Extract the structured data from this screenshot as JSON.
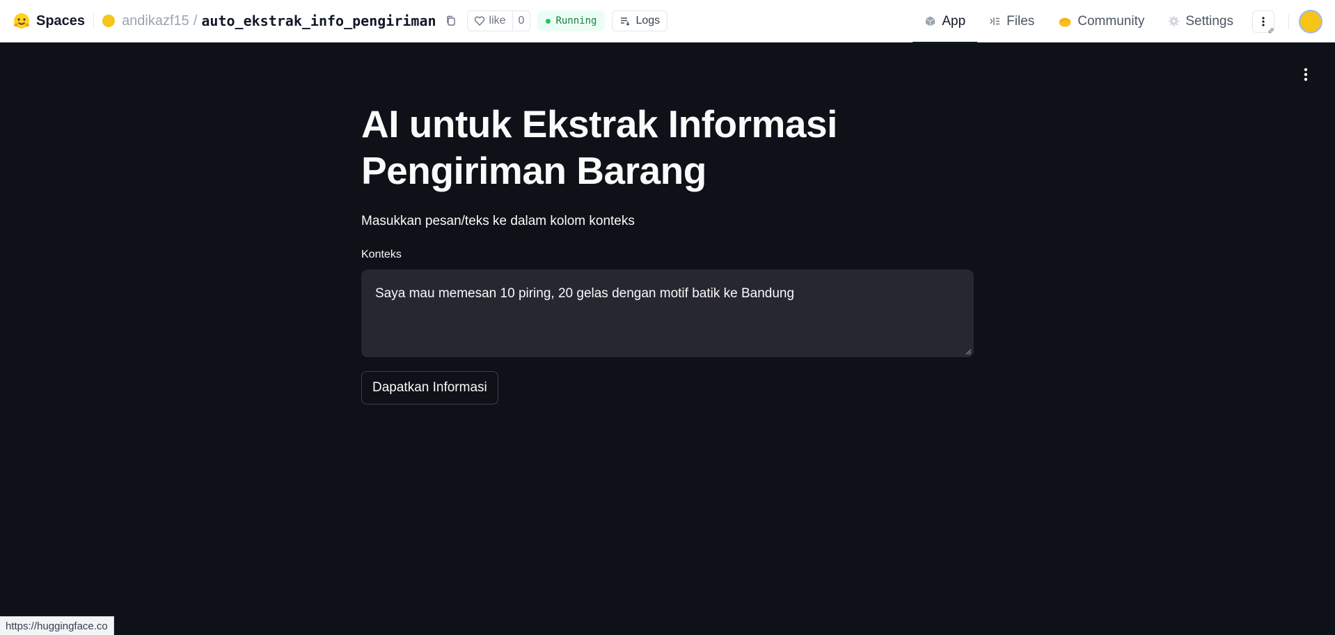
{
  "header": {
    "brand": "Spaces",
    "repo_owner": "andikazf15",
    "repo_separator": "/",
    "repo_name": "auto_ekstrak_info_pengiriman",
    "like_label": "like",
    "like_count": "0",
    "status": "Running",
    "logs_label": "Logs",
    "nav": [
      {
        "label": "App",
        "icon": "cube-icon",
        "active": true
      },
      {
        "label": "Files",
        "icon": "files-icon",
        "active": false
      },
      {
        "label": "Community",
        "icon": "community-icon",
        "active": false
      },
      {
        "label": "Settings",
        "icon": "gear-icon",
        "active": false
      }
    ],
    "colors": {
      "status_green": "#22c55e",
      "avatar": "#f5c518"
    }
  },
  "app": {
    "title_line1": "AI untuk Ekstrak Informasi",
    "title_line2": "Pengiriman Barang",
    "subtitle": "Masukkan pesan/teks ke dalam kolom konteks",
    "context_label": "Konteks",
    "context_value": "Saya mau memesan 10 piring, 20 gelas dengan motif batik ke Bandung",
    "submit_label": "Dapatkan Informasi",
    "colors": {
      "background": "#0e1117",
      "input_bg": "#262730",
      "text": "#fafafa"
    }
  },
  "status_bar": {
    "url": "https://huggingface.co"
  }
}
